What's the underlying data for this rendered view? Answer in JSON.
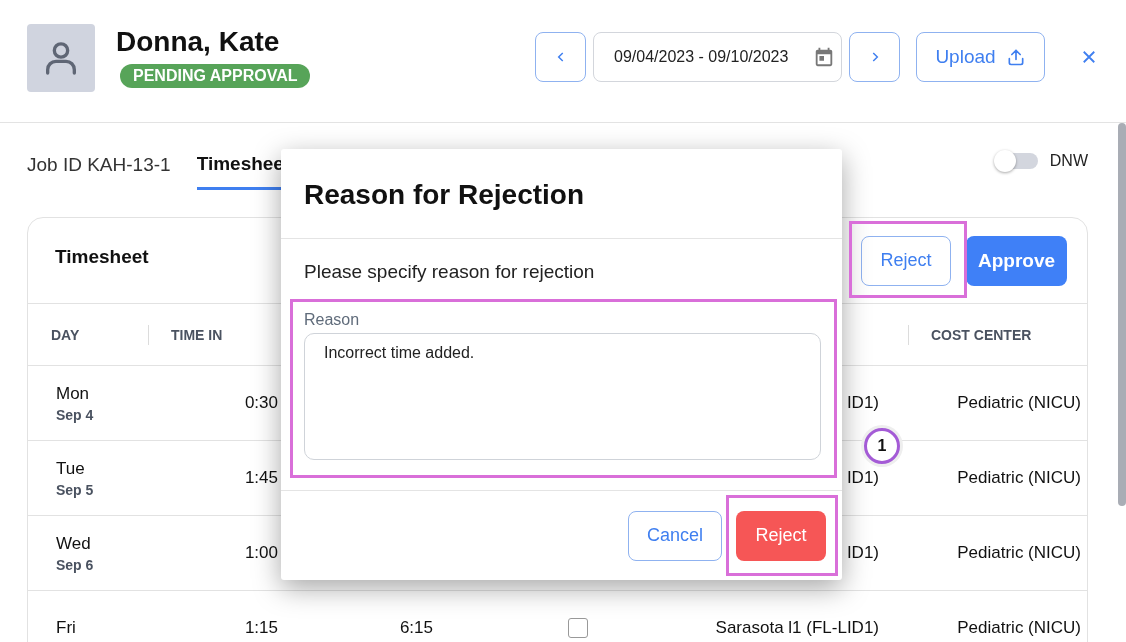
{
  "header": {
    "name": "Donna, Kate",
    "status": "PENDING APPROVAL",
    "date_range": "09/04/2023 - 09/10/2023",
    "upload": "Upload"
  },
  "job_id": "Job ID KAH-13-1",
  "tabs": [
    {
      "label": "Timeshee",
      "selected": true
    }
  ],
  "dnw": {
    "label": "DNW",
    "on": false
  },
  "card": {
    "title": "Timesheet",
    "reject": "Reject",
    "approve": "Approve"
  },
  "columns": {
    "day": "DAY",
    "time_in": "TIME IN",
    "cost_center": "COST CENTER"
  },
  "rows": [
    {
      "day": "Mon",
      "date": "Sep 4",
      "time_in": "0:30",
      "location": "ID1)",
      "cost_center": "Pediatric (NICU)"
    },
    {
      "day": "Tue",
      "date": "Sep 5",
      "time_in": "1:45",
      "location": "ID1)",
      "cost_center": "Pediatric (NICU)"
    },
    {
      "day": "Wed",
      "date": "Sep 6",
      "time_in": "1:00",
      "location": "ID1)",
      "cost_center": "Pediatric (NICU)"
    },
    {
      "day": "Fri",
      "time_in": "1:15",
      "time_out": "6:15",
      "checked": false,
      "location": "Sarasota l1 (FL-LID1)",
      "cost_center": "Pediatric (NICU)"
    }
  ],
  "dialog": {
    "title": "Reason for Rejection",
    "prompt": "Please specify reason for rejection",
    "field_label": "Reason",
    "value": "Incorrect time added.",
    "cancel": "Cancel",
    "reject": "Reject"
  },
  "step_badge": "1"
}
